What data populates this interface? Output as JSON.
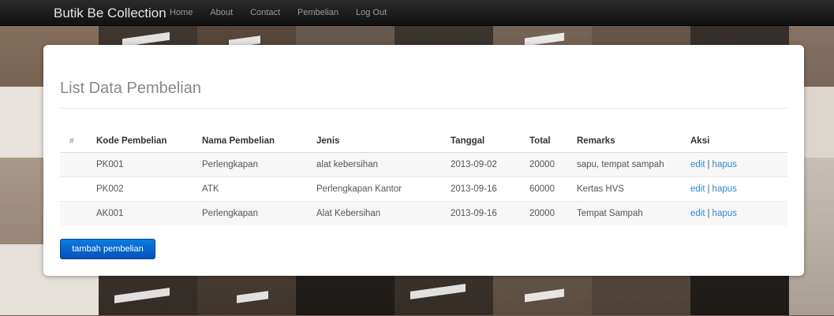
{
  "navbar": {
    "brand": "Butik Be Collection",
    "links": [
      "Home",
      "About",
      "Contact",
      "Pembelian",
      "Log Out"
    ]
  },
  "page": {
    "title": "List Data Pembelian",
    "add_button": "tambah pembelian"
  },
  "table": {
    "headers": [
      "#",
      "Kode Pembelian",
      "Nama Pembelian",
      "Jenis",
      "Tanggal",
      "Total",
      "Remarks",
      "Aksi"
    ],
    "rows": [
      {
        "kode": "PK001",
        "nama": "Perlengkapan",
        "jenis": "alat kebersihan",
        "tanggal": "2013-09-02",
        "total": "20000",
        "remarks": "sapu, tempat sampah"
      },
      {
        "kode": "PK002",
        "nama": "ATK",
        "jenis": "Perlengkapan Kantor",
        "tanggal": "2013-09-16",
        "total": "60000",
        "remarks": "Kertas HVS"
      },
      {
        "kode": "AK001",
        "nama": "Perlengkapan",
        "jenis": "Alat Kebersihan",
        "tanggal": "2013-09-16",
        "total": "20000",
        "remarks": "Tempat Sampah"
      }
    ],
    "action_edit": "edit",
    "action_separator": "|",
    "action_delete": "hapus"
  },
  "colors": {
    "navbar": "#1b1b1b",
    "link": "#2a8ad0",
    "button": "#0866cc"
  }
}
